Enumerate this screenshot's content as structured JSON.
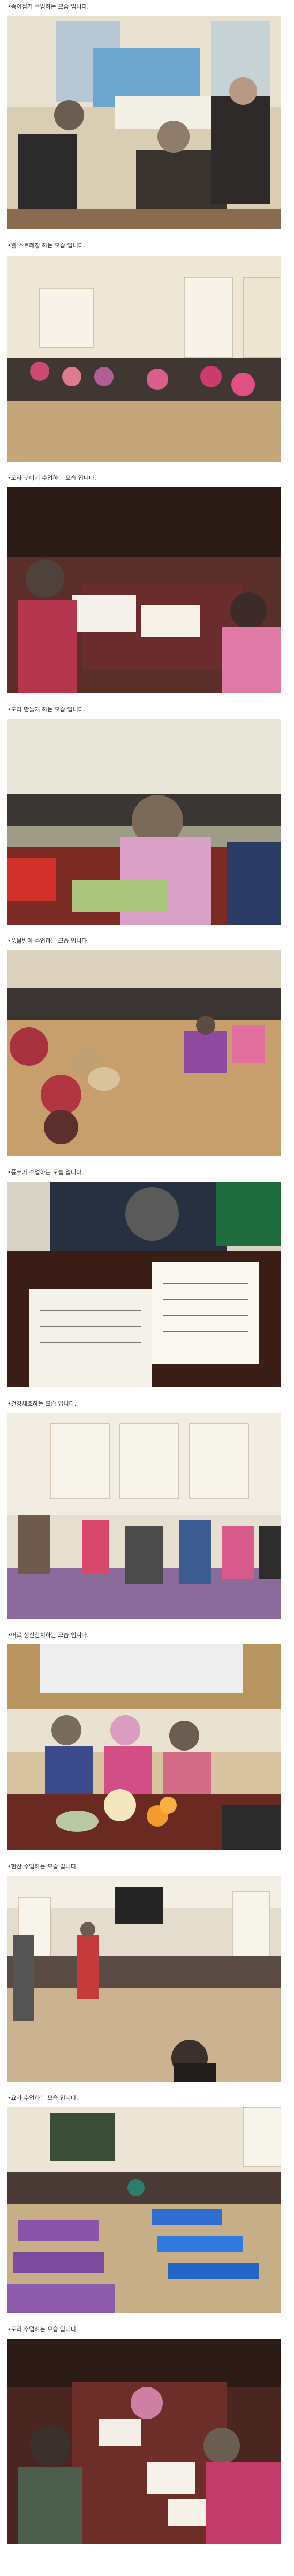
{
  "posts": [
    {
      "caption": "•종이접기 수업하는 모습 입니다.",
      "photo_icon": "photo-icon"
    },
    {
      "caption": "•웰 스트레칭 하는 모습 입니다.",
      "photo_icon": "photo-icon"
    },
    {
      "caption": "•도라 붓미기 수업하는 모습 입니다.",
      "photo_icon": "photo-icon"
    },
    {
      "caption": "•도라 만들기 하는 모습 입니다.",
      "photo_icon": "photo-icon"
    },
    {
      "caption": "•풍물반이 수업하는 모습 입니다.",
      "photo_icon": "photo-icon"
    },
    {
      "caption": "•풍쓰기 수업하는 모습 입니다.",
      "photo_icon": "photo-icon"
    },
    {
      "caption": "•건강체조하는 모습 입니다.",
      "photo_icon": "photo-icon"
    },
    {
      "caption": "•어르 생신잔치하는 모습 입니다.",
      "photo_icon": "photo-icon"
    },
    {
      "caption": "•한산 수업하는 모습 입니다.",
      "photo_icon": "photo-icon"
    },
    {
      "caption": "•요가 수업하는 모습 입니다.",
      "photo_icon": "photo-icon"
    },
    {
      "caption": "•도리 수업하는 모습 입니다.",
      "photo_icon": "photo-icon"
    }
  ]
}
